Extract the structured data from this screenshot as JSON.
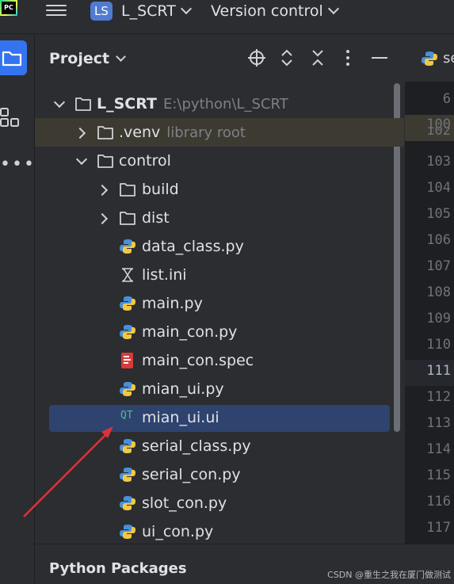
{
  "topbar": {
    "logo_text": "PC",
    "project_badge": "LS",
    "project_name": "L_SCRT",
    "vcs_label": "Version control"
  },
  "panel": {
    "title": "Project"
  },
  "tree": {
    "root": {
      "name": "L_SCRT",
      "path": "E:\\python\\L_SCRT"
    },
    "venv": {
      "name": ".venv",
      "hint": "library root"
    },
    "control": {
      "name": "control"
    },
    "build": {
      "name": "build"
    },
    "dist": {
      "name": "dist"
    },
    "files": [
      {
        "name": "data_class.py",
        "icon": "python-icon"
      },
      {
        "name": "list.ini",
        "icon": "ini-icon"
      },
      {
        "name": "main.py",
        "icon": "python-icon"
      },
      {
        "name": "main_con.py",
        "icon": "python-icon"
      },
      {
        "name": "main_con.spec",
        "icon": "spec-icon"
      },
      {
        "name": "mian_ui.py",
        "icon": "python-icon"
      },
      {
        "name": "mian_ui.ui",
        "icon": "qt-icon"
      },
      {
        "name": "serial_class.py",
        "icon": "python-icon"
      },
      {
        "name": "serial_con.py",
        "icon": "python-icon"
      },
      {
        "name": "slot_con.py",
        "icon": "python-icon"
      },
      {
        "name": "ui_con.py",
        "icon": "python-icon"
      }
    ],
    "qt_icon_text": "QT"
  },
  "editor": {
    "tab_label": "se",
    "line_numbers": [
      "6",
      "100",
      "102",
      "103",
      "104",
      "105",
      "106",
      "107",
      "108",
      "109",
      "110",
      "111",
      "112",
      "113",
      "114",
      "115",
      "116",
      "117"
    ]
  },
  "bottom": {
    "title": "Python Packages",
    "watermark": "CSDN @重生之我在厦门做测试"
  },
  "colors": {
    "accent": "#3574f0",
    "selection": "#2e436e",
    "annotation_arrow": "#e0303a"
  }
}
